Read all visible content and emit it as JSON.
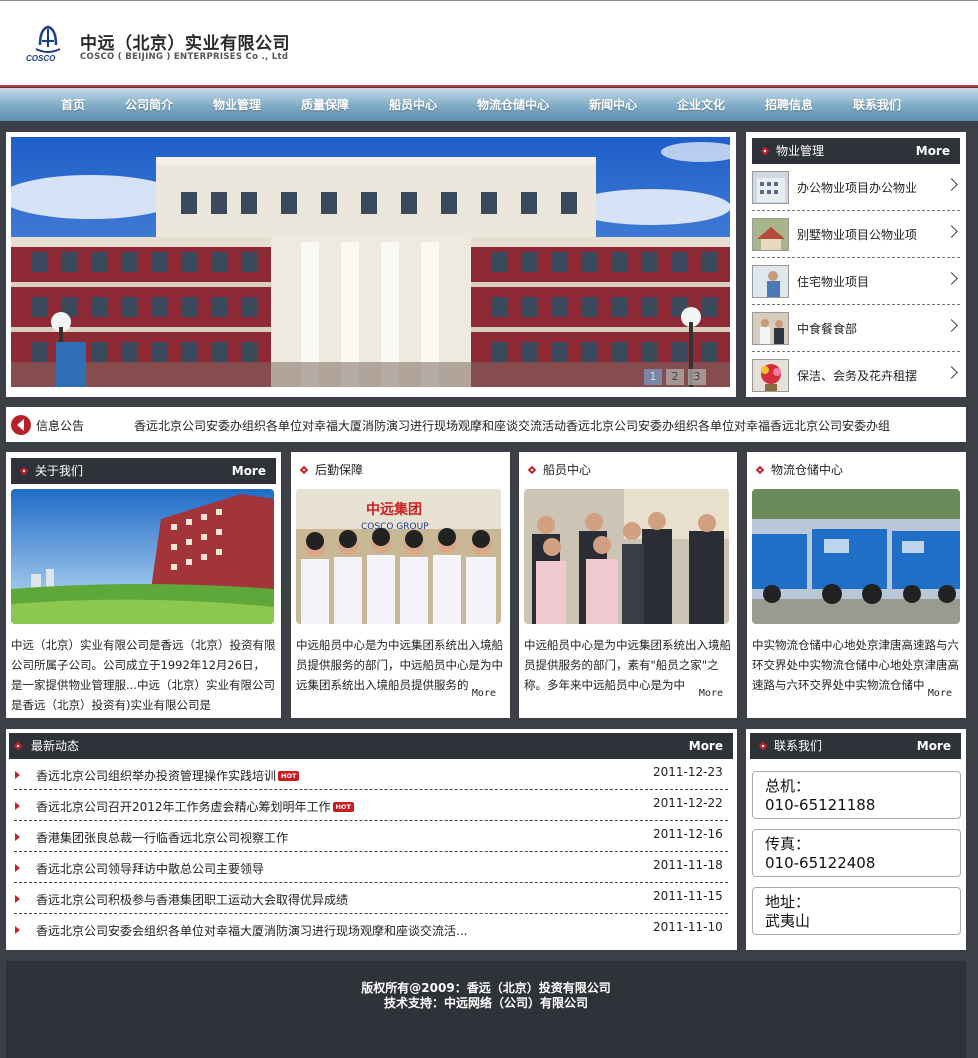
{
  "header": {
    "logo_text": "COSCO",
    "company_cn": "中远（北京）实业有限公司",
    "company_en": "COSCO ( BEIJING ) ENTERPRISES Co ., Ltd"
  },
  "nav": [
    "首页",
    "公司简介",
    "物业管理",
    "质量保障",
    "船员中心",
    "物流仓储中心",
    "新闻中心",
    "企业文化",
    "招聘信息",
    "联系我们"
  ],
  "banner": {
    "pages": [
      "1",
      "2",
      "3"
    ],
    "active_page": "1"
  },
  "property": {
    "title": "物业管理",
    "more": "More",
    "items": [
      "办公物业项目办公物业",
      "别墅物业项目公物业项",
      "住宅物业项目",
      "中食餐食部",
      "保洁、会务及花卉租摆"
    ]
  },
  "notice": {
    "label": "信息公告",
    "text": "香远北京公司安委办组织各单位对幸福大厦消防演习进行现场观摩和座谈交流活动香远北京公司安委办组织各单位对幸福香远北京公司安委办组"
  },
  "about": {
    "title": "关于我们",
    "more": "More",
    "text": "中远（北京）实业有限公司是香远（北京）投资有限公司所属子公司。公司成立于1992年12月26日，是一家提供物业管理服...中远（北京）实业有限公司是香远（北京）投资有)实业有限公司是"
  },
  "logistics_support": {
    "title": "后勤保障",
    "more": "More",
    "sign_cn": "中远集团",
    "sign_en": "COSCO GROUP",
    "text": "中远船员中心是为中远集团系统出入境船员提供服务的部门，中远船员中心是为中远集团系统出入境船员提供服务的"
  },
  "crew_center": {
    "title": "船员中心",
    "more": "More",
    "text": "中远船员中心是为中远集团系统出入境船员提供服务的部门，素有\"船员之家\"之称。多年来中远船员中心是为中"
  },
  "warehouse": {
    "title": "物流仓储中心",
    "more": "More",
    "text": "中实物流仓储中心地处京津唐高速路与六环交界处中实物流仓储中心地处京津唐高速路与六环交界处中实物流仓储中"
  },
  "news": {
    "title": "最新动态",
    "more": "More",
    "hot_label": "HOT",
    "items": [
      {
        "title": "香远北京公司组织举办投资管理操作实践培训",
        "date": "2011-12-23",
        "hot": true
      },
      {
        "title": "香远北京公司召开2012年工作务虚会精心筹划明年工作",
        "date": "2011-12-22",
        "hot": true
      },
      {
        "title": "香港集团张良总裁一行临香远北京公司视察工作",
        "date": "2011-12-16",
        "hot": false
      },
      {
        "title": "香远北京公司领导拜访中散总公司主要领导",
        "date": "2011-11-18",
        "hot": false
      },
      {
        "title": "香远北京公司积极参与香港集团职工运动大会取得优异成绩",
        "date": "2011-11-15",
        "hot": false
      },
      {
        "title": "香远北京公司安委会组织各单位对幸福大厦消防演习进行现场观摩和座谈交流活...",
        "date": "2011-11-10",
        "hot": false
      }
    ]
  },
  "contact": {
    "title": "联系我们",
    "more": "More",
    "phone_label": "总机：",
    "phone": "010-65121188",
    "fax_label": "传真：",
    "fax": "010-65122408",
    "address_label": "地址：",
    "address": "武夷山"
  },
  "footer": {
    "copyright": "版权所有@2009：香远（北京）投资有限公司",
    "support": "技术支持：中远网络（公司）有限公司"
  }
}
